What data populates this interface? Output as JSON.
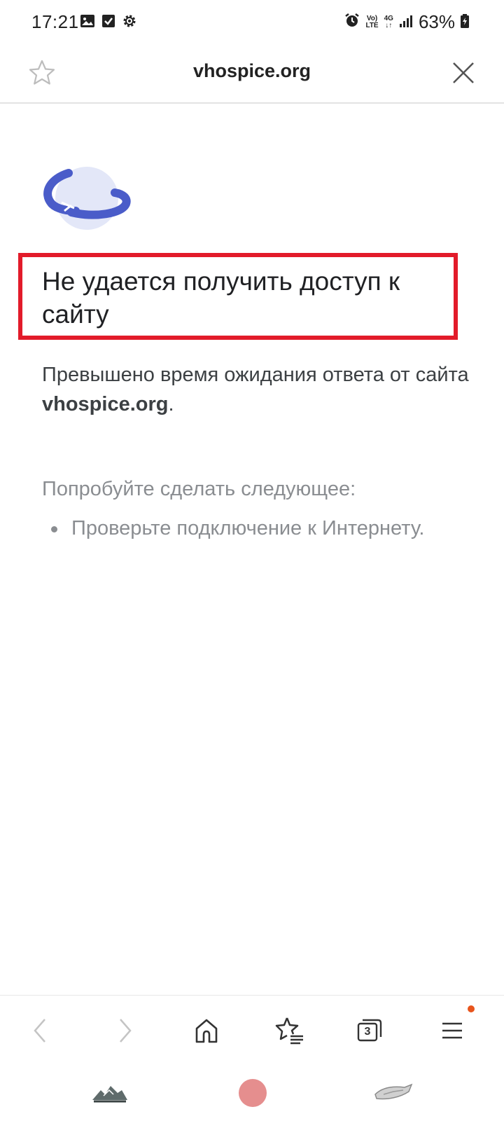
{
  "status_bar": {
    "time": "17:21",
    "left_icons": [
      "image-icon",
      "checkbox-icon",
      "settings-icon"
    ],
    "right_icons": [
      "alarm-icon",
      "volte-icon",
      "4g-icon",
      "signal-icon"
    ],
    "volte_label_top": "Vo)",
    "volte_label_bottom": "LTE",
    "network_label": "4G",
    "battery_percent": "63%"
  },
  "top_bar": {
    "title": "vhospice.org",
    "star_icon": "star-outline-icon",
    "close_icon": "close-icon"
  },
  "error_page": {
    "illustration": "planet-icon",
    "title": "Не удается получить доступ к сайту",
    "description_prefix": "Превышено время ожидания ответа от сайта ",
    "description_domain": "vhospice.org",
    "description_suffix": ".",
    "try_heading": "Попробуйте сделать следующее:",
    "try_items": [
      "Проверьте подключение к Интернету."
    ],
    "highlight_color": "#e21b2a"
  },
  "toolbar": {
    "back_icon": "chevron-left-icon",
    "forward_icon": "chevron-right-icon",
    "home_icon": "home-icon",
    "bookmarks_icon": "star-list-icon",
    "tabs_count": "3",
    "menu_icon": "hamburger-menu-icon",
    "menu_badge_color": "#e8541c"
  },
  "nav_bar": {
    "recents_icon": "recents-icon",
    "home_icon": "home-circle-icon",
    "back_icon": "back-icon"
  }
}
